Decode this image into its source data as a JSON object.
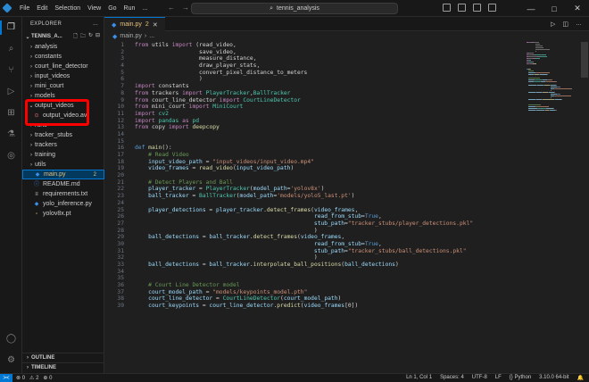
{
  "menu": [
    "File",
    "Edit",
    "Selection",
    "View",
    "Go",
    "Run",
    "..."
  ],
  "search": {
    "text": "tennis_analysis"
  },
  "window_controls": [
    "—",
    "□",
    "✕"
  ],
  "sidebar": {
    "title": "EXPLORER",
    "title_more": "...",
    "project": "TENNIS_A...",
    "items": [
      {
        "label": "analysis",
        "kind": "folder",
        "open": false
      },
      {
        "label": "constants",
        "kind": "folder",
        "open": false
      },
      {
        "label": "court_line_detector",
        "kind": "folder",
        "open": false
      },
      {
        "label": "input_videos",
        "kind": "folder",
        "open": false
      },
      {
        "label": "mini_court",
        "kind": "folder",
        "open": false
      },
      {
        "label": "models",
        "kind": "folder",
        "open": false
      },
      {
        "label": "output_videos",
        "kind": "folder",
        "open": true
      },
      {
        "label": "output_video.avi",
        "kind": "video"
      },
      {
        "label": "runs",
        "kind": "folder",
        "open": false
      },
      {
        "label": "tracker_stubs",
        "kind": "folder",
        "open": false
      },
      {
        "label": "trackers",
        "kind": "folder",
        "open": false
      },
      {
        "label": "training",
        "kind": "folder",
        "open": false
      },
      {
        "label": "utils",
        "kind": "folder",
        "open": false
      },
      {
        "label": "main.py",
        "kind": "python",
        "badge": "2",
        "selected": true
      },
      {
        "label": "README.md",
        "kind": "markdown"
      },
      {
        "label": "requirements.txt",
        "kind": "text"
      },
      {
        "label": "yolo_inference.py",
        "kind": "python"
      },
      {
        "label": "yolov8x.pt",
        "kind": "file"
      }
    ],
    "outline": "OUTLINE",
    "timeline": "TIMELINE"
  },
  "editor": {
    "tab": "main.py",
    "tab_badge": "2",
    "breadcrumb": "main.py",
    "breadcrumb_more": "...",
    "lines": [
      {
        "n": "1",
        "t": [
          [
            "kw",
            "from "
          ],
          [
            "pl",
            "utils "
          ],
          [
            "kw",
            "import "
          ],
          [
            "pl",
            "(read_video,"
          ]
        ]
      },
      {
        "n": "2",
        "t": [
          [
            "pl",
            "                   save_video,"
          ]
        ]
      },
      {
        "n": "3",
        "t": [
          [
            "pl",
            "                   measure_distance,"
          ]
        ]
      },
      {
        "n": "4",
        "t": [
          [
            "pl",
            "                   draw_player_stats,"
          ]
        ]
      },
      {
        "n": "5",
        "t": [
          [
            "pl",
            "                   convert_pixel_distance_to_meters"
          ]
        ]
      },
      {
        "n": "6",
        "t": [
          [
            "pl",
            "                   )"
          ]
        ]
      },
      {
        "n": "7",
        "t": [
          [
            "kw",
            "import "
          ],
          [
            "pl",
            "constants"
          ]
        ]
      },
      {
        "n": "8",
        "t": [
          [
            "kw",
            "from "
          ],
          [
            "pl",
            "trackers "
          ],
          [
            "kw",
            "import "
          ],
          [
            "cls",
            "PlayerTracker"
          ],
          [
            "pl",
            ","
          ],
          [
            "cls",
            "BallTracker"
          ]
        ]
      },
      {
        "n": "9",
        "t": [
          [
            "kw",
            "from "
          ],
          [
            "pl",
            "court_line_detector "
          ],
          [
            "kw",
            "import "
          ],
          [
            "cls",
            "CourtLineDetector"
          ]
        ]
      },
      {
        "n": "10",
        "t": [
          [
            "kw",
            "from "
          ],
          [
            "pl",
            "mini_court "
          ],
          [
            "kw",
            "import "
          ],
          [
            "cls",
            "MiniCourt"
          ]
        ]
      },
      {
        "n": "11",
        "t": [
          [
            "kw",
            "import "
          ],
          [
            "cls",
            "cv2"
          ]
        ]
      },
      {
        "n": "12",
        "t": [
          [
            "kw",
            "import "
          ],
          [
            "cls",
            "pandas "
          ],
          [
            "kw",
            "as "
          ],
          [
            "cls",
            "pd"
          ]
        ]
      },
      {
        "n": "13",
        "t": [
          [
            "kw",
            "from "
          ],
          [
            "pl",
            "copy "
          ],
          [
            "kw",
            "import "
          ],
          [
            "fn",
            "deepcopy"
          ]
        ]
      },
      {
        "n": "14",
        "t": []
      },
      {
        "n": "15",
        "t": []
      },
      {
        "n": "16",
        "t": [
          [
            "kw2",
            "def "
          ],
          [
            "fn",
            "main"
          ],
          [
            "pl",
            "():"
          ]
        ]
      },
      {
        "n": "17",
        "t": [
          [
            "cm",
            "    # Read Video"
          ]
        ]
      },
      {
        "n": "18",
        "t": [
          [
            "var",
            "    input_video_path "
          ],
          [
            "pl",
            "= "
          ],
          [
            "str",
            "\"input_videos/input_video.mp4\""
          ]
        ]
      },
      {
        "n": "19",
        "t": [
          [
            "var",
            "    video_frames "
          ],
          [
            "pl",
            "= "
          ],
          [
            "fn",
            "read_video"
          ],
          [
            "pl",
            "("
          ],
          [
            "var",
            "input_video_path"
          ],
          [
            "pl",
            ")"
          ]
        ]
      },
      {
        "n": "20",
        "t": []
      },
      {
        "n": "21",
        "t": [
          [
            "cm",
            "    # Detect Players and Ball"
          ]
        ]
      },
      {
        "n": "22",
        "t": [
          [
            "var",
            "    player_tracker "
          ],
          [
            "pl",
            "= "
          ],
          [
            "cls",
            "PlayerTracker"
          ],
          [
            "pl",
            "("
          ],
          [
            "var",
            "model_path"
          ],
          [
            "pl",
            "="
          ],
          [
            "str",
            "'yolov8x'"
          ],
          [
            "pl",
            ")"
          ]
        ]
      },
      {
        "n": "23",
        "t": [
          [
            "var",
            "    ball_tracker "
          ],
          [
            "pl",
            "= "
          ],
          [
            "cls",
            "BallTracker"
          ],
          [
            "pl",
            "("
          ],
          [
            "var",
            "model_path"
          ],
          [
            "pl",
            "="
          ],
          [
            "str",
            "'models/yolo5_last.pt'"
          ],
          [
            "pl",
            ")"
          ]
        ]
      },
      {
        "n": "24",
        "t": []
      },
      {
        "n": "25",
        "t": [
          [
            "var",
            "    player_detections "
          ],
          [
            "pl",
            "= "
          ],
          [
            "var",
            "player_tracker"
          ],
          [
            "pl",
            "."
          ],
          [
            "fn",
            "detect_frames"
          ],
          [
            "pl",
            "("
          ],
          [
            "var",
            "video_frames"
          ],
          [
            "pl",
            ","
          ]
        ]
      },
      {
        "n": "26",
        "t": [
          [
            "var",
            "                                                     read_from_stub"
          ],
          [
            "pl",
            "="
          ],
          [
            "kw2",
            "True"
          ],
          [
            "pl",
            ","
          ]
        ]
      },
      {
        "n": "27",
        "t": [
          [
            "var",
            "                                                     stub_path"
          ],
          [
            "pl",
            "="
          ],
          [
            "str",
            "\"tracker_stubs/player_detections.pkl\""
          ]
        ]
      },
      {
        "n": "28",
        "t": [
          [
            "pl",
            "                                                     )"
          ]
        ]
      },
      {
        "n": "29",
        "t": [
          [
            "var",
            "    ball_detections "
          ],
          [
            "pl",
            "= "
          ],
          [
            "var",
            "ball_tracker"
          ],
          [
            "pl",
            "."
          ],
          [
            "fn",
            "detect_frames"
          ],
          [
            "pl",
            "("
          ],
          [
            "var",
            "video_frames"
          ],
          [
            "pl",
            ","
          ]
        ]
      },
      {
        "n": "30",
        "t": [
          [
            "var",
            "                                                     read_from_stub"
          ],
          [
            "pl",
            "="
          ],
          [
            "kw2",
            "True"
          ],
          [
            "pl",
            ","
          ]
        ]
      },
      {
        "n": "31",
        "t": [
          [
            "var",
            "                                                     stub_path"
          ],
          [
            "pl",
            "="
          ],
          [
            "str",
            "\"tracker_stubs/ball_detections.pkl\""
          ]
        ]
      },
      {
        "n": "32",
        "t": [
          [
            "pl",
            "                                                     )"
          ]
        ]
      },
      {
        "n": "33",
        "t": [
          [
            "var",
            "    ball_detections "
          ],
          [
            "pl",
            "= "
          ],
          [
            "var",
            "ball_tracker"
          ],
          [
            "pl",
            "."
          ],
          [
            "fn",
            "interpolate_ball_positions"
          ],
          [
            "pl",
            "("
          ],
          [
            "var",
            "ball_detections"
          ],
          [
            "pl",
            ")"
          ]
        ]
      },
      {
        "n": "34",
        "t": []
      },
      {
        "n": "35",
        "t": []
      },
      {
        "n": "36",
        "t": [
          [
            "cm",
            "    # Court Line Detector model"
          ]
        ]
      },
      {
        "n": "37",
        "t": [
          [
            "var",
            "    court_model_path "
          ],
          [
            "pl",
            "= "
          ],
          [
            "str",
            "\"models/keypoints_model.pth\""
          ]
        ]
      },
      {
        "n": "38",
        "t": [
          [
            "var",
            "    court_line_detector "
          ],
          [
            "pl",
            "= "
          ],
          [
            "cls",
            "CourtLineDetector"
          ],
          [
            "pl",
            "("
          ],
          [
            "var",
            "court_model_path"
          ],
          [
            "pl",
            ")"
          ]
        ]
      },
      {
        "n": "39",
        "t": [
          [
            "var",
            "    court_keypoints "
          ],
          [
            "pl",
            "= "
          ],
          [
            "var",
            "court_line_detector"
          ],
          [
            "pl",
            "."
          ],
          [
            "fn",
            "predict"
          ],
          [
            "pl",
            "("
          ],
          [
            "var",
            "video_frames"
          ],
          [
            "pl",
            "[0])"
          ]
        ]
      }
    ]
  },
  "status": {
    "remote": "><",
    "errors": "⊗ 0",
    "warnings": "⚠ 2",
    "ports": "⊕ 0",
    "position": "Ln 1, Col 1",
    "spaces": "Spaces: 4",
    "encoding": "UTF-8",
    "eol": "LF",
    "language": "{} Python",
    "interpreter": "3.10.0 64-bit",
    "bell": "🔔"
  },
  "colors": {
    "accent": "#0078d4",
    "highlight_box": "#ff0000",
    "background": "#1f1f1f"
  }
}
